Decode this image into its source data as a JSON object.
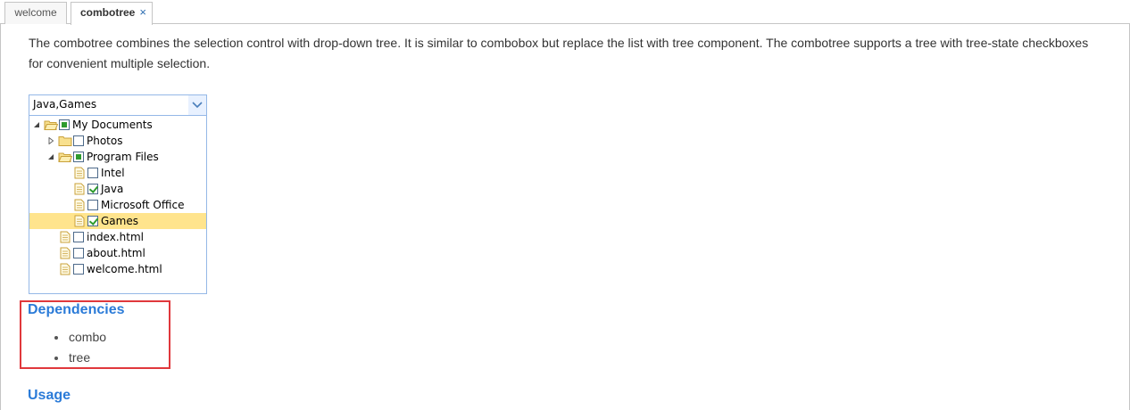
{
  "tabs": [
    {
      "label": "welcome"
    },
    {
      "label": "combotree",
      "close": "×"
    }
  ],
  "description": "The combotree combines the selection control with drop-down tree. It is similar to combobox but replace the list with tree component. The combotree supports a tree with tree-state checkboxes for convenient multiple selection.",
  "combo": {
    "value": "Java,Games"
  },
  "tree": {
    "nodes": [
      {
        "label": "My Documents"
      },
      {
        "label": "Photos"
      },
      {
        "label": "Program Files"
      },
      {
        "label": "Intel"
      },
      {
        "label": "Java"
      },
      {
        "label": "Microsoft Office"
      },
      {
        "label": "Games"
      },
      {
        "label": "index.html"
      },
      {
        "label": "about.html"
      },
      {
        "label": "welcome.html"
      }
    ]
  },
  "dependencies": {
    "title": "Dependencies",
    "items": [
      "combo",
      "tree"
    ]
  },
  "usage": {
    "title": "Usage"
  },
  "colors": {
    "accent": "#2b7bd8",
    "highlight": "#e0383c",
    "selected_row": "#ffe48d",
    "check": "#2e9b2e"
  }
}
